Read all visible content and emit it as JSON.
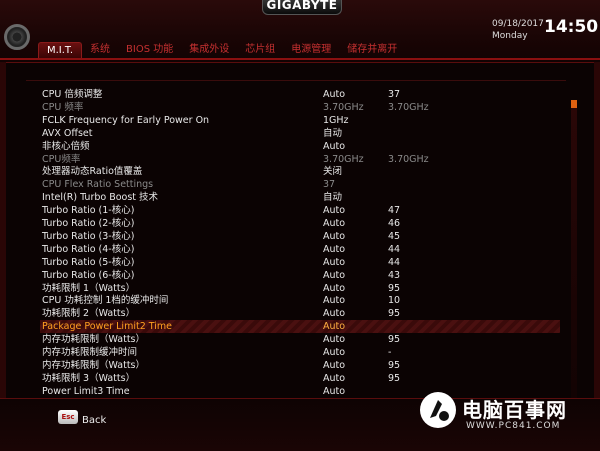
{
  "brand": "GIGABYTE",
  "date": "09/18/2017",
  "weekday": "Monday",
  "time": "14:50",
  "tabs": [
    {
      "label": "M.I.T.",
      "active": true
    },
    {
      "label": "系统",
      "active": false
    },
    {
      "label": "BIOS 功能",
      "active": false
    },
    {
      "label": "集成外设",
      "active": false
    },
    {
      "label": "芯片组",
      "active": false
    },
    {
      "label": "电源管理",
      "active": false
    },
    {
      "label": "储存并离开",
      "active": false
    }
  ],
  "rows": [
    {
      "label": "CPU 倍频调整",
      "value": "Auto",
      "current": "37",
      "state": "normal"
    },
    {
      "label": "CPU 频率",
      "value": "3.70GHz",
      "current": "3.70GHz",
      "state": "dim"
    },
    {
      "label": "FCLK Frequency for Early Power On",
      "value": "1GHz",
      "current": "",
      "state": "normal"
    },
    {
      "label": "AVX Offset",
      "value": "自动",
      "current": "",
      "state": "normal"
    },
    {
      "label": "非核心倍频",
      "value": "Auto",
      "current": "",
      "state": "normal"
    },
    {
      "label": "CPU频率",
      "value": "3.70GHz",
      "current": "3.70GHz",
      "state": "dim"
    },
    {
      "label": "处理器动态Ratio值覆盖",
      "value": "关闭",
      "current": "",
      "state": "normal"
    },
    {
      "label": "CPU Flex Ratio Settings",
      "value": "37",
      "current": "",
      "state": "dim"
    },
    {
      "label": "Intel(R) Turbo Boost 技术",
      "value": "自动",
      "current": "",
      "state": "normal"
    },
    {
      "label": "  Turbo Ratio (1-核心)",
      "value": "Auto",
      "current": "47",
      "state": "normal"
    },
    {
      "label": "  Turbo Ratio (2-核心)",
      "value": "Auto",
      "current": "46",
      "state": "normal"
    },
    {
      "label": "  Turbo Ratio (3-核心)",
      "value": "Auto",
      "current": "45",
      "state": "normal"
    },
    {
      "label": "  Turbo Ratio (4-核心)",
      "value": "Auto",
      "current": "44",
      "state": "normal"
    },
    {
      "label": "  Turbo Ratio (5-核心)",
      "value": "Auto",
      "current": "44",
      "state": "normal"
    },
    {
      "label": "  Turbo Ratio (6-核心)",
      "value": "Auto",
      "current": "43",
      "state": "normal"
    },
    {
      "label": "功耗限制 1（Watts）",
      "value": "Auto",
      "current": "95",
      "state": "normal"
    },
    {
      "label": "CPU 功耗控制 1档的缓冲时间",
      "value": "Auto",
      "current": "10",
      "state": "normal"
    },
    {
      "label": "功耗限制 2（Watts）",
      "value": "Auto",
      "current": "95",
      "state": "normal"
    },
    {
      "label": "Package Power Limit2 Time",
      "value": "Auto",
      "current": "",
      "state": "selected"
    },
    {
      "label": "内存功耗限制（Watts）",
      "value": "Auto",
      "current": "95",
      "state": "normal"
    },
    {
      "label": "内存功耗限制缓冲时间",
      "value": "Auto",
      "current": "-",
      "state": "normal"
    },
    {
      "label": "内存功耗限制（Watts）",
      "value": "Auto",
      "current": "95",
      "state": "normal"
    },
    {
      "label": "功耗限制 3（Watts）",
      "value": "Auto",
      "current": "95",
      "state": "normal"
    },
    {
      "label": "Power Limit3 Time",
      "value": "Auto",
      "current": "",
      "state": "normal"
    }
  ],
  "footer": {
    "esc_key": "Esc",
    "back_label": "Back"
  },
  "watermark": {
    "title": "电脑百事网",
    "url": "WWW.PC841.COM"
  }
}
